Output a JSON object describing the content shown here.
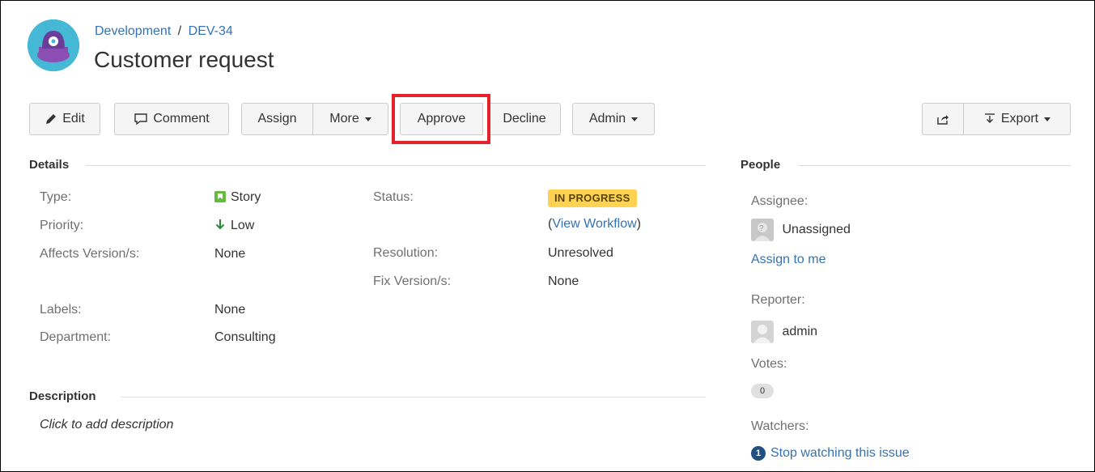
{
  "breadcrumb": {
    "project": "Development",
    "separator": "/",
    "issue_key": "DEV-34"
  },
  "issue": {
    "title": "Customer request"
  },
  "toolbar": {
    "edit": "Edit",
    "comment": "Comment",
    "assign": "Assign",
    "more": "More",
    "approve": "Approve",
    "decline": "Decline",
    "admin": "Admin",
    "export": "Export"
  },
  "details": {
    "heading": "Details",
    "type_label": "Type:",
    "type_value": "Story",
    "priority_label": "Priority:",
    "priority_value": "Low",
    "affects_label": "Affects Version/s:",
    "affects_value": "None",
    "labels_label": "Labels:",
    "labels_value": "None",
    "department_label": "Department:",
    "department_value": "Consulting",
    "status_label": "Status:",
    "status_value": "IN PROGRESS",
    "workflow_open": "(",
    "workflow_link": "View Workflow",
    "workflow_close": ")",
    "resolution_label": "Resolution:",
    "resolution_value": "Unresolved",
    "fix_label": "Fix Version/s:",
    "fix_value": "None"
  },
  "description": {
    "heading": "Description",
    "placeholder": "Click to add description"
  },
  "people": {
    "heading": "People",
    "assignee_label": "Assignee:",
    "assignee_value": "Unassigned",
    "assign_to_me": "Assign to me",
    "reporter_label": "Reporter:",
    "reporter_value": "admin",
    "votes_label": "Votes:",
    "votes_count": "0",
    "watchers_label": "Watchers:",
    "watchers_count": "1",
    "stop_watching": "Stop watching this issue"
  },
  "colors": {
    "link": "#3572b0",
    "status": "#ffd351",
    "highlight": "#e5222b",
    "story": "#63ba3c"
  }
}
